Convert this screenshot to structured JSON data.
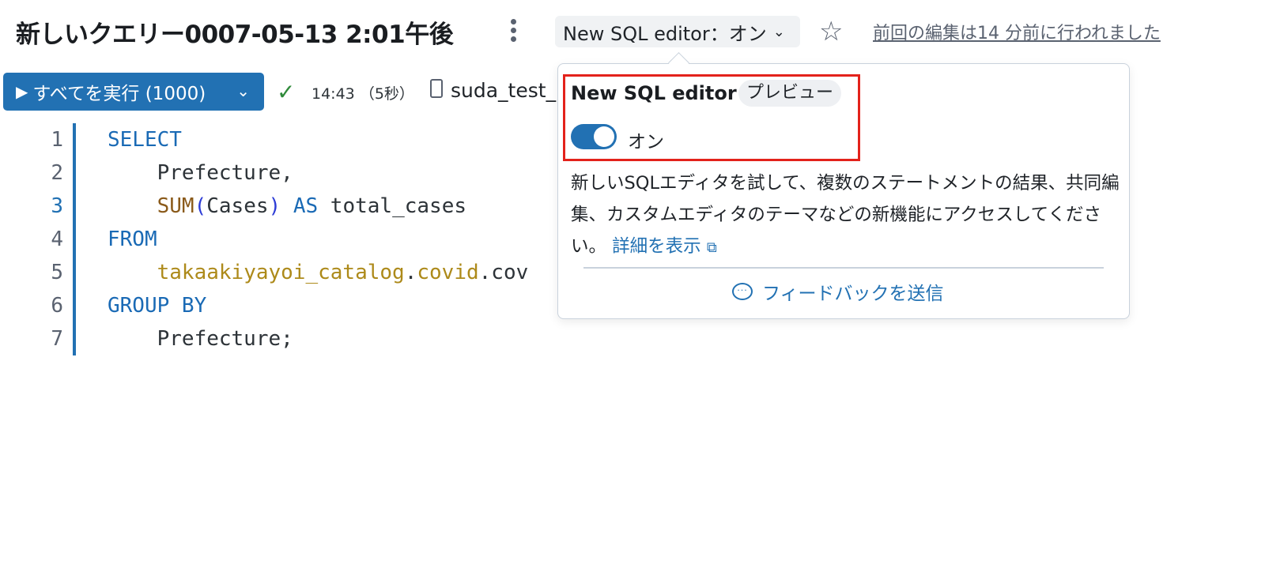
{
  "header": {
    "title": "新しいクエリー0007-05-13 2:01午後",
    "editor_toggle_label": "New SQL editor：オン",
    "last_edit": "前回の編集は14 分前に行われました"
  },
  "toolbar": {
    "run_label": "すべてを実行 (1000)",
    "time": "14:43",
    "duration": "（5秒）",
    "database": "suda_test_"
  },
  "editor": {
    "active_line": 3,
    "lines": [
      "1",
      "2",
      "3",
      "4",
      "5",
      "6",
      "7"
    ],
    "code": {
      "l1_kw": "SELECT",
      "l2_ident": "    Prefecture,",
      "l3_indent": "    ",
      "l3_fn": "SUM",
      "l3_paren_open": "(",
      "l3_arg": "Cases",
      "l3_paren_close": ")",
      "l3_as": " AS",
      "l3_alias": " total_cases",
      "l4_kw": "FROM",
      "l5_indent": "    ",
      "l5_catalog": "takaakiyayoi_catalog",
      "l5_dot1": ".",
      "l5_schema": "covid",
      "l5_dot2": ".",
      "l5_table": "cov",
      "l6_kw": "GROUP BY",
      "l7_ident": "    Prefecture;"
    }
  },
  "popover": {
    "title": "New SQL editor",
    "badge": "プレビュー",
    "switch_label": "オン",
    "description": "新しいSQLエディタを試して、複数のステートメントの結果、共同編集、カスタムエディタのテーマなどの新機能にアクセスしてください。",
    "link": "詳細を表示",
    "feedback": "フィードバックを送信"
  },
  "colors": {
    "accent": "#2271b3",
    "highlight": "#e3221b",
    "success": "#2f8a3a"
  },
  "icons": [
    "kebab-icon",
    "chevron-down-icon",
    "star-icon",
    "play-icon",
    "check-icon",
    "database-icon",
    "external-link-icon",
    "feedback-icon"
  ]
}
